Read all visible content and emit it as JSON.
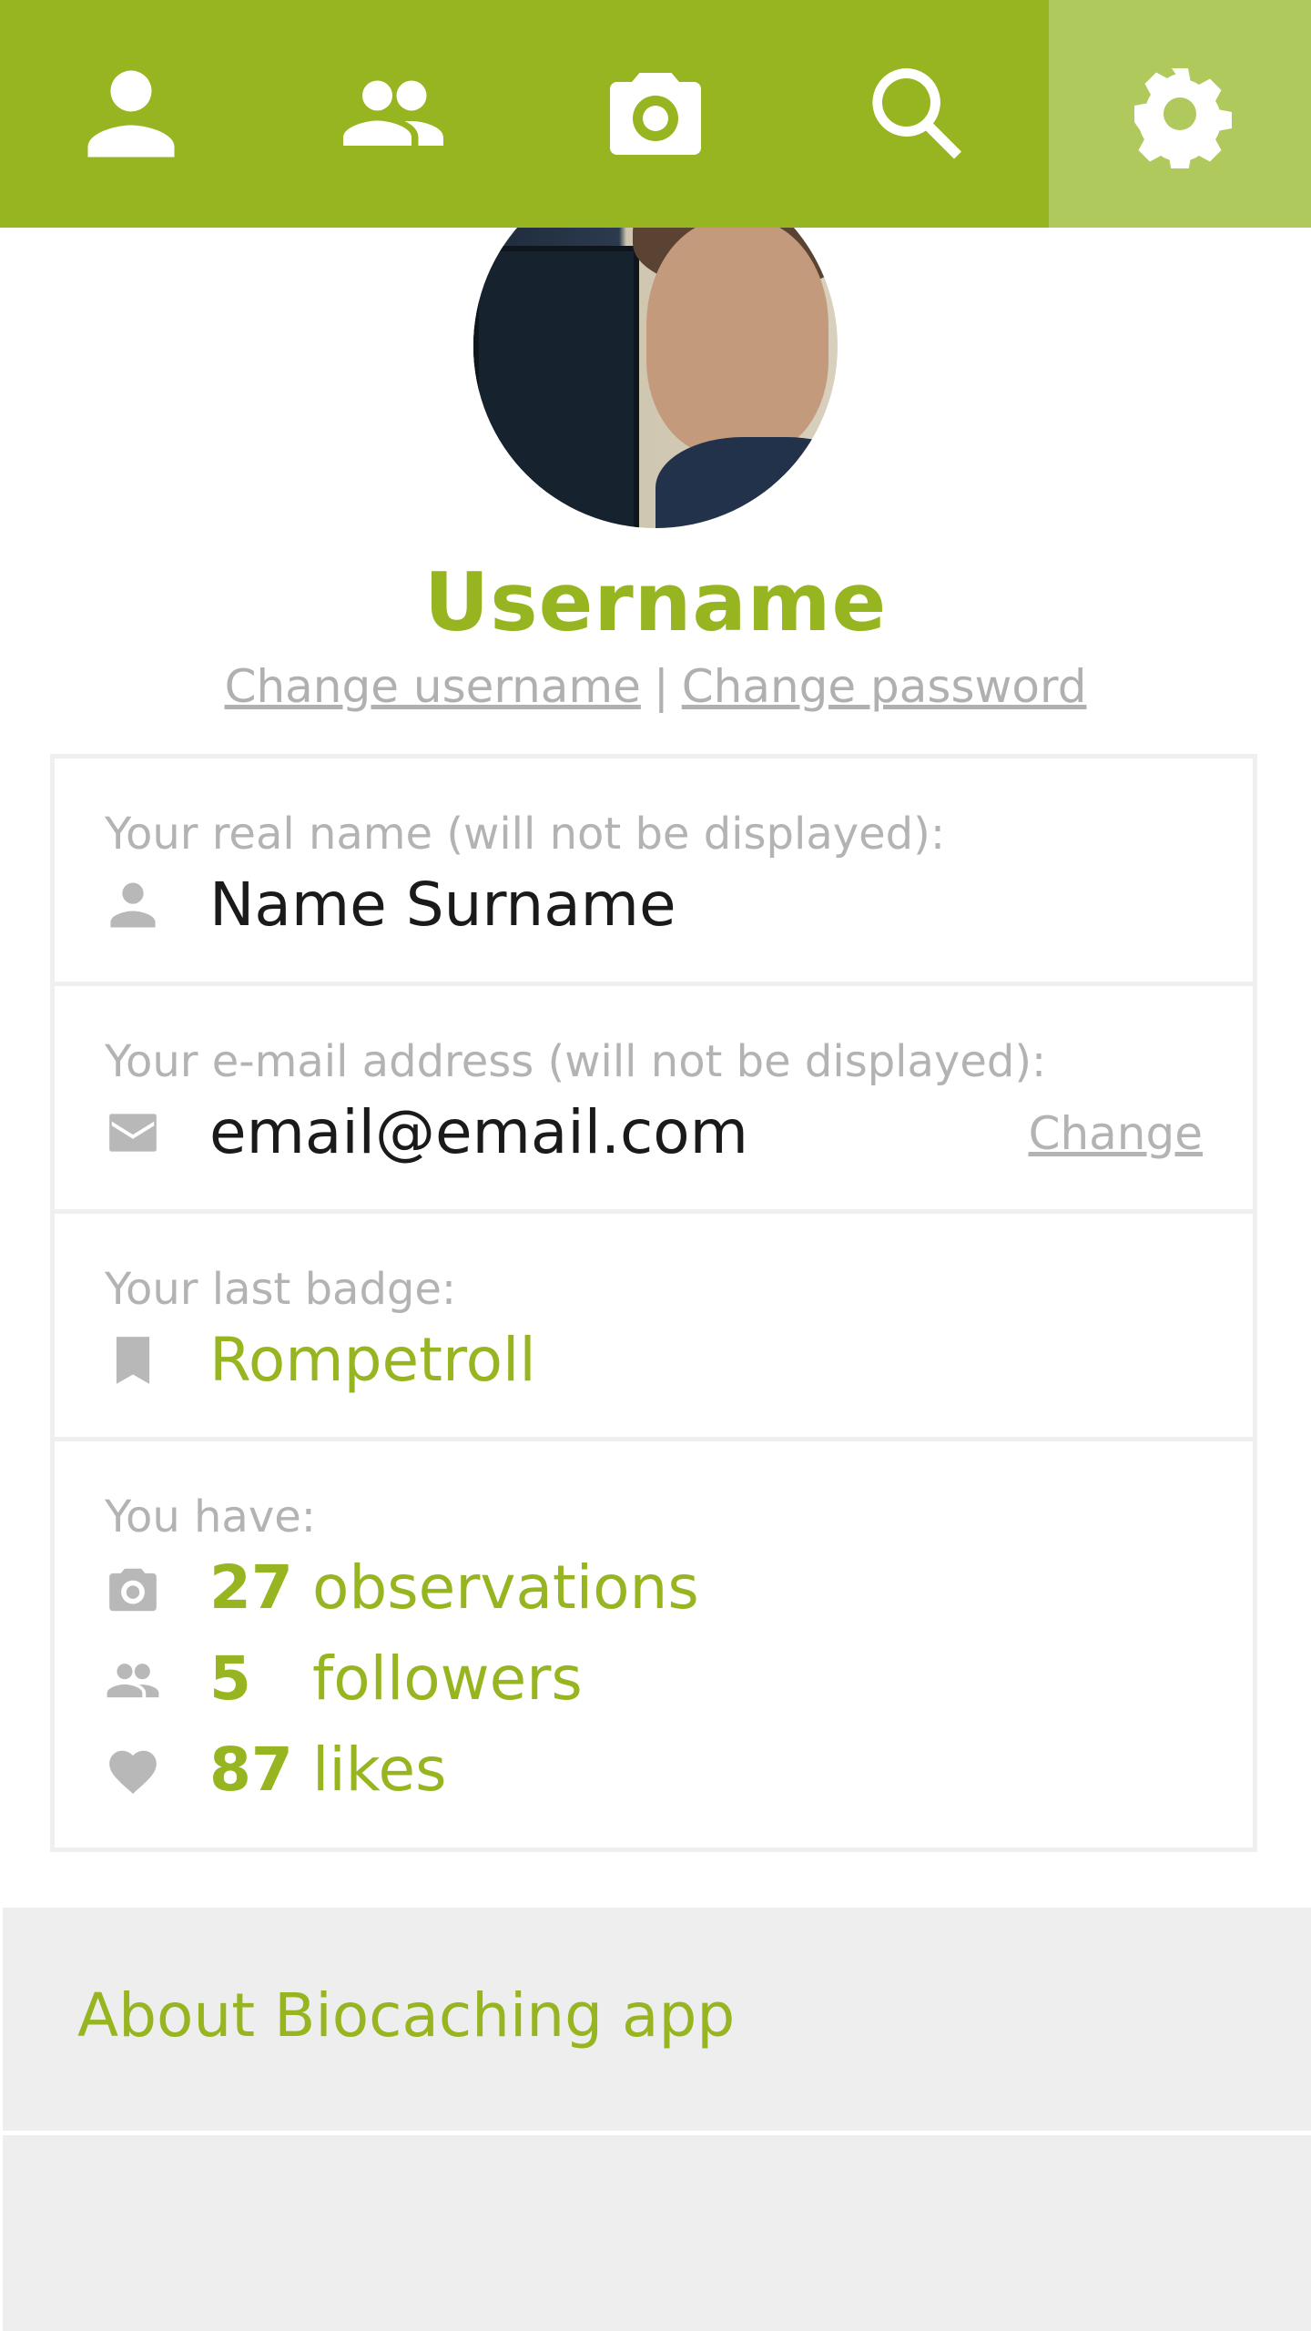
{
  "nav": {
    "tabs": [
      {
        "name": "profile",
        "icon": "person-icon"
      },
      {
        "name": "friends",
        "icon": "people-icon"
      },
      {
        "name": "camera",
        "icon": "camera-icon"
      },
      {
        "name": "search",
        "icon": "search-icon"
      },
      {
        "name": "settings",
        "icon": "gear-icon",
        "active": true
      }
    ]
  },
  "profile": {
    "username": "Username",
    "change_username": "Change username",
    "separator": "|",
    "change_password": "Change password"
  },
  "info": {
    "real_name_label": "Your real name (will not be displayed):",
    "real_name": "Name Surname",
    "email_label": "Your e-mail address (will not be displayed):",
    "email": "email@email.com",
    "email_change": "Change",
    "badge_label": "Your last badge:",
    "badge": "Rompetroll",
    "stats_label": "You have:",
    "stats": [
      {
        "icon": "camera-icon",
        "count": "27",
        "word": "observations"
      },
      {
        "icon": "people-icon",
        "count": "5",
        "word": "followers"
      },
      {
        "icon": "heart-icon",
        "count": "87",
        "word": "likes"
      }
    ]
  },
  "about": {
    "label": "About Biocaching app"
  },
  "colors": {
    "accent": "#96b521",
    "active_tab": "#b0c95c",
    "muted": "#b3b3b3",
    "panel": "#eeeeee"
  }
}
